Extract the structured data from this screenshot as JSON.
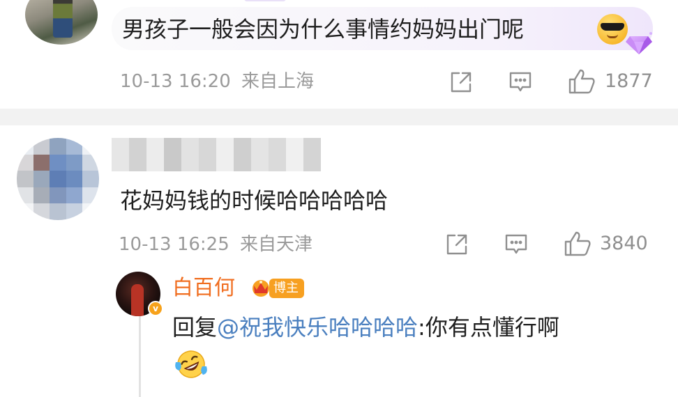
{
  "comment1": {
    "text": "男孩子一般会因为什么事情约妈妈出门呢",
    "emoji": "cool-sunglasses-emoji",
    "time": "10-13 16:20",
    "location": "来自上海",
    "likes": "1877"
  },
  "comment2": {
    "text": "花妈妈钱的时候哈哈哈哈哈",
    "time": "10-13 16:25",
    "location": "来自天津",
    "likes": "3840"
  },
  "reply": {
    "username": "白百何",
    "badge": "博主",
    "verified_mark": "v",
    "prefix": "回复",
    "mention": "@祝我快乐哈哈哈哈",
    "separator": ":",
    "body": "你有点懂行啊",
    "emoji": "laughing-tears-emoji"
  },
  "icons": {
    "share": "share-icon",
    "comment": "comment-icon",
    "like": "thumbs-up-icon"
  },
  "colors": {
    "username_orange": "#f06d1f",
    "mention_blue": "#4a7fbf",
    "meta_gray": "#9a9a9a",
    "badge_orange": "#f7a021"
  }
}
